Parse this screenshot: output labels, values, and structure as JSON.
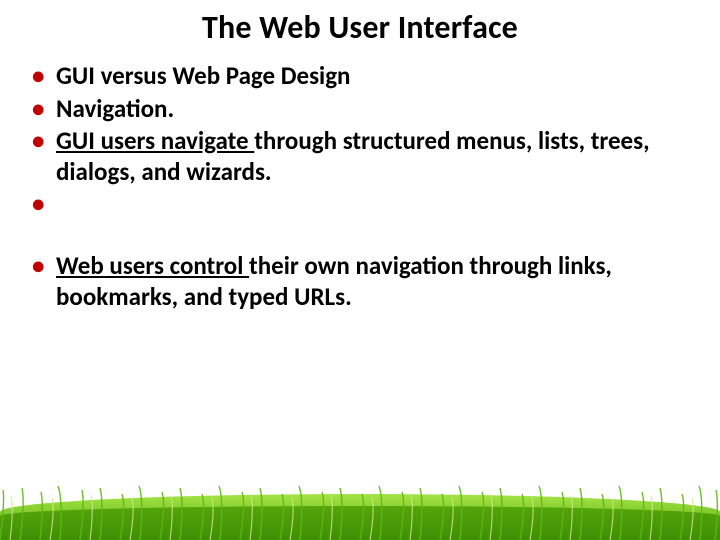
{
  "title": "The Web User Interface",
  "bullets": {
    "b0": {
      "text": "GUI versus Web Page Design"
    },
    "b1": {
      "text": "Navigation."
    },
    "b2": {
      "u1": "GUI users navigate ",
      "rest": "through structured menus, lists, trees, dialogs, and wizards."
    },
    "b3": {
      "text": ""
    },
    "b4": {
      "u1": "Web users control ",
      "rest": "their own navigation through links, bookmarks, and typed URLs."
    }
  },
  "colors": {
    "bullet": "#c00000",
    "grass_light": "#a0e23c",
    "grass_mid": "#6fc11a",
    "grass_dark": "#3f8f05"
  }
}
